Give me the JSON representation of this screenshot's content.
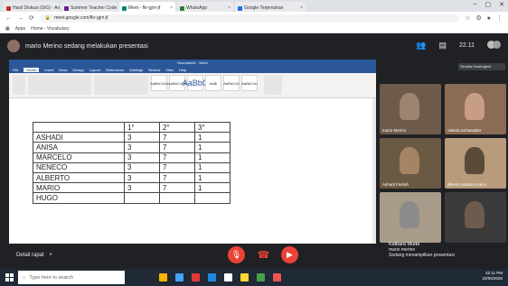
{
  "browser": {
    "tabs": [
      {
        "label": "Hasil Diskusi (SIG) - Aref",
        "color": "#c62828"
      },
      {
        "label": "Summer Teacher Code",
        "color": "#6a1b9a"
      },
      {
        "label": "Meet - fkr-gjrn-jf",
        "color": "#00897b"
      },
      {
        "label": "WhatsApp",
        "color": "#2e7d32"
      },
      {
        "label": "Google Terjemahan",
        "color": "#1a73e8"
      }
    ],
    "url": "meet.google.com/fkr-gjrn-jf",
    "bookmarks": [
      "Apps",
      "Home - Vocabulary"
    ]
  },
  "meet": {
    "presenter_banner": "mario Merino sedang melakukan presentasi",
    "clock": "22.11",
    "host_card": "Simalia Hostingfeld",
    "details_label": "Detail rapat",
    "presenting_title": "Kalbara Muda",
    "presenting_sub1": "mario merino",
    "presenting_sub2": "Sedang menampilkan presentasi"
  },
  "word": {
    "title": "Document1 - Word",
    "tabs": [
      "File",
      "Home",
      "Insert",
      "Draw",
      "Design",
      "Layout",
      "References",
      "Mailings",
      "Review",
      "View",
      "Help"
    ],
    "styles": [
      "AaBbCcDd",
      "AaBbCcDd",
      "AaBbC",
      "AaBl",
      "AaBbCcD",
      "AaBbCcD"
    ]
  },
  "table": {
    "header": [
      "",
      "1°",
      "2°",
      "3°"
    ],
    "rows": [
      [
        "ASHADI",
        "3",
        "7",
        "1"
      ],
      [
        "ANISA",
        "3",
        "7",
        "1"
      ],
      [
        "MARCELO",
        "3",
        "7",
        "1"
      ],
      [
        "NENECO",
        "3",
        "7",
        "1"
      ],
      [
        "ALBERTO",
        "3",
        "7",
        "1"
      ],
      [
        "MARIO",
        "3",
        "7",
        "1"
      ],
      [
        "HUGO",
        "",
        "",
        ""
      ]
    ]
  },
  "participants": [
    {
      "name": "mario Merino",
      "bg": "#6d5a4a",
      "person": "#9e8470"
    },
    {
      "name": "Valeria Schawatter",
      "bg": "#8a6b55",
      "person": "#c89d86"
    },
    {
      "name": "Ashadi Farkah",
      "bg": "#6b5a43",
      "person": "#a48563"
    },
    {
      "name": "alberto polanco mario",
      "bg": "#b79b7b",
      "person": "#5a4a3a"
    },
    {
      "name": "",
      "bg": "#a99b8a",
      "person": "#8b8b8b"
    },
    {
      "name": "",
      "bg": "#3a3a3a",
      "person": "#6e5b4c"
    }
  ],
  "taskbar": {
    "search_placeholder": "Type here to search",
    "time": "22:11 PM",
    "date": "22/05/2020",
    "icon_colors": [
      "#ffb300",
      "#42a5f5",
      "#e53935",
      "#1e88e5",
      "#ffffff",
      "#fdd835",
      "#43a047",
      "#ef5350"
    ]
  }
}
